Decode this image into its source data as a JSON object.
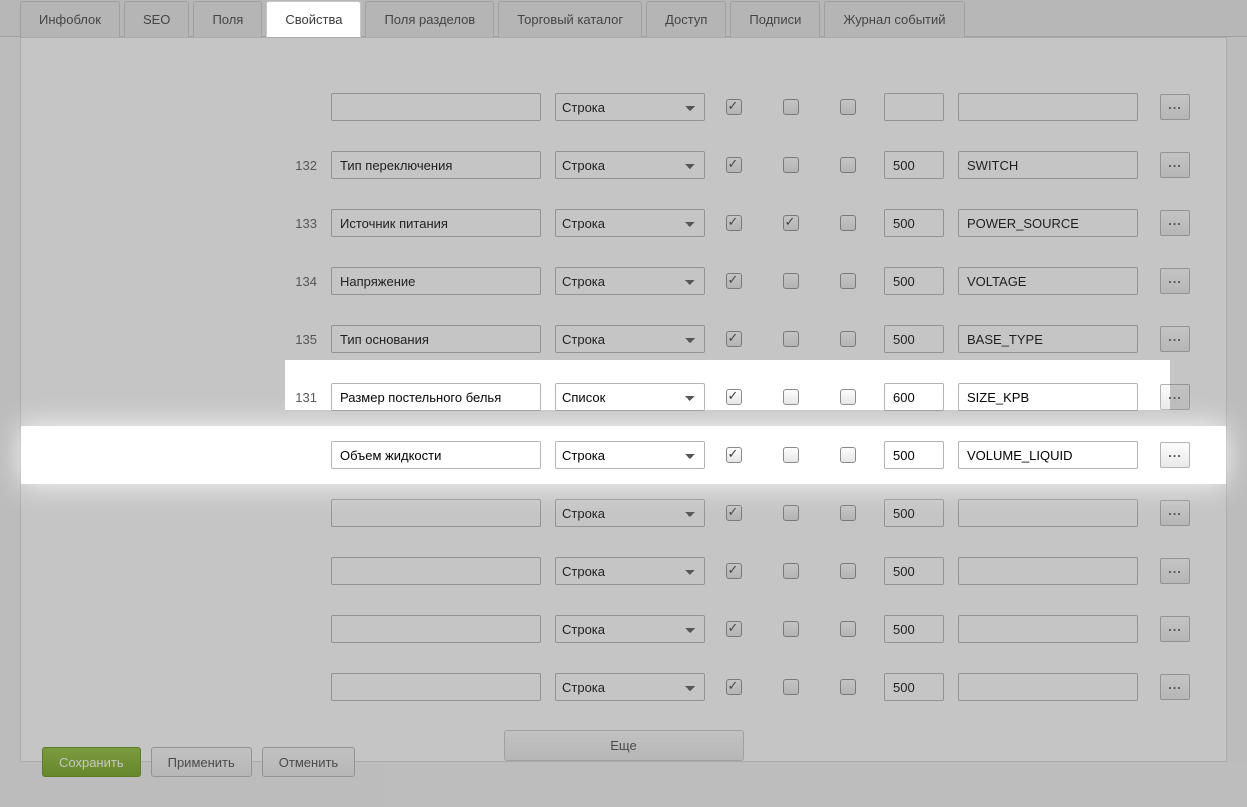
{
  "tabs": [
    {
      "label": "Инфоблок"
    },
    {
      "label": "SEO"
    },
    {
      "label": "Поля"
    },
    {
      "label": "Свойства",
      "active": true
    },
    {
      "label": "Поля разделов"
    },
    {
      "label": "Торговый каталог"
    },
    {
      "label": "Доступ"
    },
    {
      "label": "Подписи"
    },
    {
      "label": "Журнал событий"
    }
  ],
  "type_options": {
    "stroka": "Строка",
    "spisok": "Список"
  },
  "rows": [
    {
      "id": "",
      "name": "",
      "type": "Строка",
      "c1": true,
      "c2": false,
      "c3": false,
      "sort": "",
      "code": ""
    },
    {
      "id": "132",
      "name": "Тип переключения",
      "type": "Строка",
      "c1": true,
      "c2": false,
      "c3": false,
      "sort": "500",
      "code": "SWITCH"
    },
    {
      "id": "133",
      "name": "Источник питания",
      "type": "Строка",
      "c1": true,
      "c2": true,
      "c3": false,
      "sort": "500",
      "code": "POWER_SOURCE"
    },
    {
      "id": "134",
      "name": "Напряжение",
      "type": "Строка",
      "c1": true,
      "c2": false,
      "c3": false,
      "sort": "500",
      "code": "VOLTAGE"
    },
    {
      "id": "135",
      "name": "Тип основания",
      "type": "Строка",
      "c1": true,
      "c2": false,
      "c3": false,
      "sort": "500",
      "code": "BASE_TYPE"
    },
    {
      "id": "131",
      "name": "Размер постельного белья",
      "type": "Список",
      "c1": true,
      "c2": false,
      "c3": false,
      "sort": "600",
      "code": "SIZE_KPB"
    },
    {
      "id": "",
      "name": "Объем жидкости",
      "type": "Строка",
      "c1": true,
      "c2": false,
      "c3": false,
      "sort": "500",
      "code": "VOLUME_LIQUID",
      "highlight": true
    },
    {
      "id": "",
      "name": "",
      "type": "Строка",
      "c1": true,
      "c2": false,
      "c3": false,
      "sort": "500",
      "code": ""
    },
    {
      "id": "",
      "name": "",
      "type": "Строка",
      "c1": true,
      "c2": false,
      "c3": false,
      "sort": "500",
      "code": ""
    },
    {
      "id": "",
      "name": "",
      "type": "Строка",
      "c1": true,
      "c2": false,
      "c3": false,
      "sort": "500",
      "code": ""
    },
    {
      "id": "",
      "name": "",
      "type": "Строка",
      "c1": true,
      "c2": false,
      "c3": false,
      "sort": "500",
      "code": ""
    }
  ],
  "more_label": "Еще",
  "buttons": {
    "save": "Сохранить",
    "apply": "Применить",
    "cancel": "Отменить"
  },
  "dots": "..."
}
